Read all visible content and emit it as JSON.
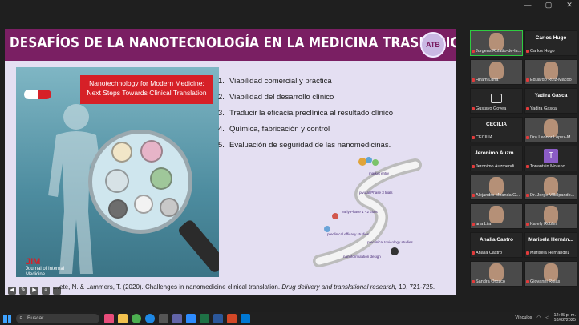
{
  "window": {
    "controls": [
      "—",
      "▢",
      "✕"
    ]
  },
  "slide": {
    "title": "DESAFÍOS DE LA NANOTECNOLOGÍA EN LA MEDICINA TRASLACIONAL",
    "logo_text": "ATB",
    "cover": {
      "banner": "Nanotechnology for Modern Medicine: Next Steps Towards Clinical Translation",
      "journal_mark": "JIM",
      "journal_name": "Journal of Internal Medicine"
    },
    "items": [
      {
        "num": "1.",
        "text": "Viabilidad comercial y práctica"
      },
      {
        "num": "2.",
        "text": "Viabilidad del desarrollo clínico"
      },
      {
        "num": "3.",
        "text": "Traducir la eficacia preclínica al resultado clínico"
      },
      {
        "num": "4.",
        "text": "Química, fabricación y control"
      },
      {
        "num": "5.",
        "text": "Evaluación de seguridad de las nanomedicinas."
      }
    ],
    "diagram_labels": {
      "market": "market entry",
      "phase13": "pivotal Phase 3 trials",
      "phase12": "early Phase 1 - 2 trials",
      "efficacy": "preclinical efficacy studies",
      "toxicology": "preclinical toxicology studies",
      "design": "nanoformulation design"
    },
    "citation_prefix": "…ete, N. & Lammers, T. (2020). Challenges in nanomedicine clinical translation.",
    "citation_journal": "Drug delivery and translational research,",
    "citation_suffix": "10, 721-725."
  },
  "participants": [
    {
      "big": "",
      "small": "Jurgens Rolatto-de-la...",
      "type": "video",
      "active": true
    },
    {
      "big": "Carlos Hugo",
      "small": "Carlos Hugo",
      "type": "name"
    },
    {
      "big": "",
      "small": "Hiram Luna",
      "type": "video"
    },
    {
      "big": "",
      "small": "Eduardo Ruiz-Macoo",
      "type": "video"
    },
    {
      "big": "",
      "small": "Gustavo Govea",
      "type": "camoff"
    },
    {
      "big": "Yadira Gasca",
      "small": "Yadira Gasca",
      "type": "name"
    },
    {
      "big": "CECILIA",
      "small": "CECILIA",
      "type": "name"
    },
    {
      "big": "",
      "small": "Dra Leonor López-M...",
      "type": "video"
    },
    {
      "big": "Jeronimo Auzm...",
      "small": "Jeronimo Auzmendi",
      "type": "name"
    },
    {
      "big": "T",
      "small": "Tonantzin Moreno",
      "type": "avatar"
    },
    {
      "big": "",
      "small": "Alejandro Miranda G...",
      "type": "video"
    },
    {
      "big": "",
      "small": "Dr. Jorge Villalpando...",
      "type": "video"
    },
    {
      "big": "",
      "small": "ana Lila",
      "type": "video"
    },
    {
      "big": "",
      "small": "Karely Robles",
      "type": "video"
    },
    {
      "big": "Analia Castro",
      "small": "Analia Castro",
      "type": "name"
    },
    {
      "big": "Marisela Hernán...",
      "small": "Marisela Hernández",
      "type": "name"
    },
    {
      "big": "",
      "small": "Sandra Orozco",
      "type": "video"
    },
    {
      "big": "",
      "small": "Giovanni Rojas",
      "type": "video"
    }
  ],
  "taskbar": {
    "search_label": "Buscar",
    "tray_text": "Vínculos",
    "time": "12:45 p. m.",
    "date": "18/02/2025"
  }
}
